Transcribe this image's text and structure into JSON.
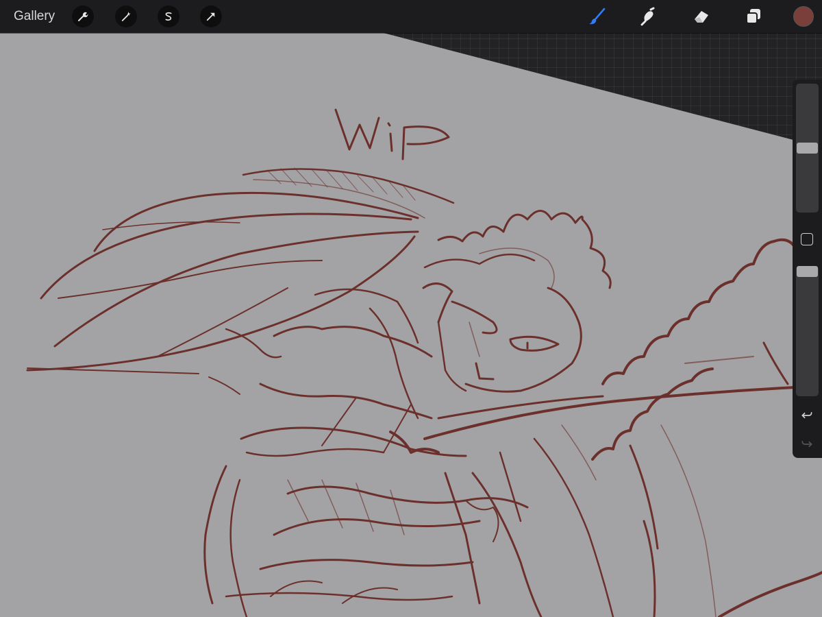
{
  "toolbar": {
    "gallery_label": "Gallery",
    "left_icons": [
      "wrench-icon",
      "magic-wand-icon",
      "selection-s-icon",
      "arrow-cursor-icon"
    ],
    "right_icons": [
      "brush-icon",
      "smudge-icon",
      "eraser-icon",
      "layers-icon"
    ],
    "active_tool": "brush",
    "active_color": "#7a3f3a",
    "accent_color": "#2f7cf6"
  },
  "sidebar": {
    "brush_size": 0.5,
    "opacity": 1.0,
    "icons": [
      "modify-square-icon",
      "undo-icon",
      "redo-icon"
    ]
  },
  "canvas": {
    "background_color": "#a3a3a5",
    "stroke_color": "#6b2f2c",
    "annotation_text": "WiP"
  }
}
